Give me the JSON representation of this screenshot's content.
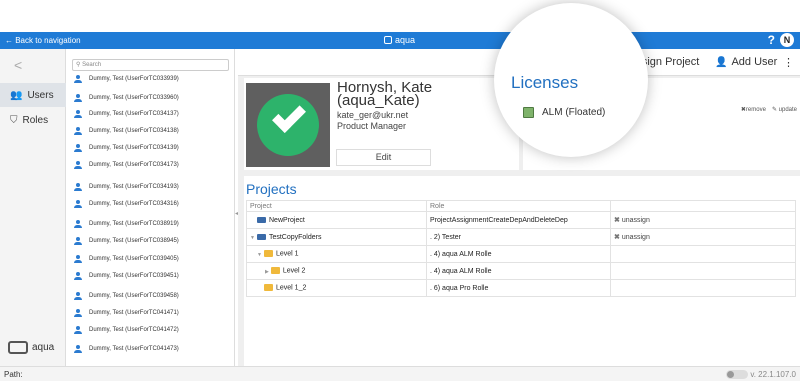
{
  "titlebar": {
    "back_label": "← Back to navigation",
    "app_title": "aqua",
    "help": "?"
  },
  "nav": {
    "collapse": "<",
    "items": [
      {
        "label": "Users",
        "icon": "users-icon"
      },
      {
        "label": "Roles",
        "icon": "shield-icon"
      }
    ],
    "brand": "aqua"
  },
  "userlist": {
    "search_placeholder": "Search",
    "users": [
      "Dummy, Test (UserForTC033939)",
      "Dummy, Test (UserForTC033960)",
      "Dummy, Test (UserForTC034137)",
      "Dummy, Test (UserForTC034138)",
      "Dummy, Test (UserForTC034139)",
      "Dummy, Test (UserForTC034173)",
      "Dummy, Test (UserForTC034193)",
      "Dummy, Test (UserForTC034316)",
      "Dummy, Test (UserForTC038919)",
      "Dummy, Test (UserForTC038945)",
      "Dummy, Test (UserForTC039405)",
      "Dummy, Test (UserForTC039451)",
      "Dummy, Test (UserForTC039458)",
      "Dummy, Test (UserForTC041471)",
      "Dummy, Test (UserForTC041472)",
      "Dummy, Test (UserForTC041473)"
    ]
  },
  "toolbar": {
    "assign_project": "Assign Project",
    "add_user": "Add User",
    "more": "⋮"
  },
  "profile": {
    "name_line1": "Hornysh, Kate",
    "name_line2": "(aqua_Kate)",
    "email": "kate_ger@ukr.net",
    "role": "Product Manager",
    "edit_label": "Edit"
  },
  "licenses": {
    "title": "Licenses",
    "items": [
      {
        "label": "ALM (Floated)"
      }
    ],
    "remove_label": "remove",
    "update_label": "update"
  },
  "projects": {
    "title": "Projects",
    "columns": [
      "Project",
      "Role",
      ""
    ],
    "rows": [
      {
        "project": "NewProject",
        "role": "ProjectAssignmentCreateDepAndDeleteDep",
        "action": "unassign"
      },
      {
        "project": "TestCopyFolders",
        "role": ". 2) Tester",
        "action": "unassign"
      },
      {
        "project": "Level 1",
        "role": ". 4) aqua ALM Rolle",
        "action": ""
      },
      {
        "project": "Level 2",
        "role": ". 4) aqua ALM Rolle",
        "action": ""
      },
      {
        "project": "Level 1_2",
        "role": ". 6) aqua Pro Rolle",
        "action": ""
      }
    ]
  },
  "statusbar": {
    "path_label": "Path:",
    "version": "v. 22.1.107.0"
  },
  "colors": {
    "titlebar": "#1f7bd6",
    "accent": "#2270c0",
    "check_badge": "#2db36b"
  }
}
